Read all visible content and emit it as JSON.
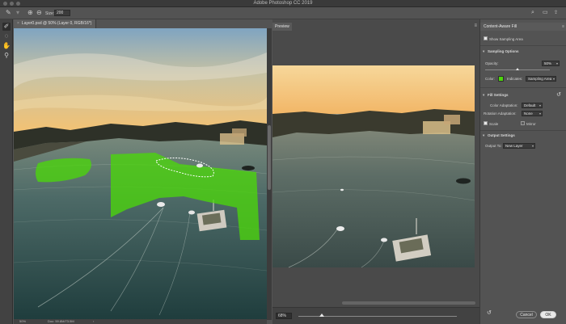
{
  "app": {
    "title": "Adobe Photoshop CC 2019"
  },
  "options_bar": {
    "size_label": "Size:",
    "size_value": "200"
  },
  "document": {
    "tab_title": "Layer0.psd @ 50% (Layer 0, RGB/16*)",
    "zoom": "50%",
    "doc_info": "Doc: 59.8M/73.5M"
  },
  "preview": {
    "tab_label": "Preview",
    "zoom": "68%",
    "zoom_fraction": 0.15
  },
  "caf": {
    "title": "Content-Aware Fill",
    "show_sampling_area": "Show Sampling Area",
    "sampling_options": "Sampling Options",
    "opacity_label": "Opacity:",
    "opacity_value": "50%",
    "opacity_fraction": 0.5,
    "color_label": "Color:",
    "indicates_label": "Indicates:",
    "indicates_value": "Sampling Area",
    "fill_settings": "Fill Settings",
    "color_adaptation_label": "Color Adaptation:",
    "color_adaptation_value": "Default",
    "rotation_adaptation_label": "Rotation Adaptation:",
    "rotation_adaptation_value": "None",
    "scale_label": "Scale",
    "mirror_label": "Mirror",
    "output_settings": "Output Settings",
    "output_to_label": "Output To:",
    "output_to_value": "New Layer",
    "cancel": "Cancel",
    "ok": "OK"
  },
  "colors": {
    "sampling_green": "#4cd60b",
    "sky_top": "#8fb0c8",
    "sky_bottom": "#f2c071",
    "water": "#3e5a58"
  },
  "icons": {
    "toolbar": [
      "sampling-brush-icon",
      "lasso-icon",
      "hand-icon",
      "zoom-icon"
    ]
  }
}
